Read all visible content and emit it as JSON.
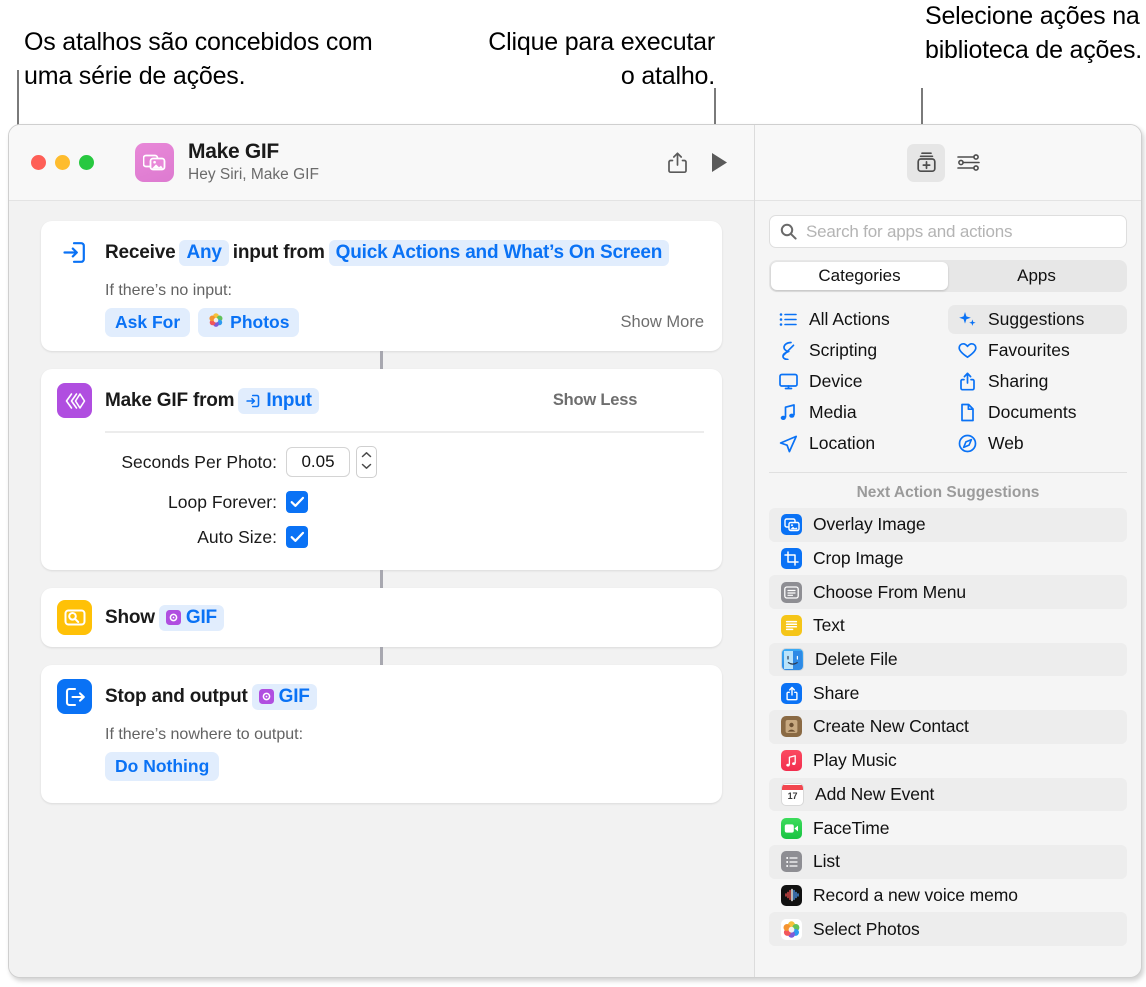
{
  "callouts": [
    {
      "id": "callout-shortcuts-series",
      "text": "Os atalhos são concebidos com uma série de ações."
    },
    {
      "id": "callout-run-shortcut",
      "text": "Clique para executar o atalho."
    },
    {
      "id": "callout-action-library",
      "text": "Selecione ações na biblioteca de ações."
    }
  ],
  "window": {
    "titlebar": {
      "app_icon": "photos-stack-icon",
      "title": "Make GIF",
      "subtitle": "Hey Siri, Make GIF",
      "share_button": "share-icon",
      "play_button": "play-icon",
      "action_library_button": "add-action-icon",
      "shortcut_details_button": "sliders-icon"
    },
    "actions": [
      {
        "icon": "receive-input-icon",
        "icon_color": "#ffffff",
        "title_parts": [
          {
            "type": "text",
            "text": "Receive"
          },
          {
            "type": "token",
            "text": "Any"
          },
          {
            "type": "text",
            "text": "input from"
          },
          {
            "type": "token",
            "text": "Quick Actions and What’s On Screen"
          }
        ],
        "toggle": "Show More",
        "sub_label": "If there’s no input:",
        "pills": [
          {
            "text": "Ask For",
            "icon": null
          },
          {
            "text": "Photos",
            "icon": "photos-icon"
          }
        ]
      },
      {
        "icon": "make-gif-icon",
        "icon_color": "#b04ee0",
        "title_parts": [
          {
            "type": "text",
            "text": "Make GIF from"
          },
          {
            "type": "token",
            "text": "Input",
            "icon": "input-icon"
          }
        ],
        "toggle": "Show Less",
        "params": [
          {
            "label": "Seconds Per Photo:",
            "type": "number",
            "value": "0.05"
          },
          {
            "label": "Loop Forever:",
            "type": "checkbox",
            "value": true
          },
          {
            "label": "Auto Size:",
            "type": "checkbox",
            "value": true
          }
        ]
      },
      {
        "icon": "quick-look-icon",
        "icon_color": "#ffc107",
        "title_parts": [
          {
            "type": "text",
            "text": "Show"
          },
          {
            "type": "token",
            "text": "GIF",
            "icon": "gif-var-icon"
          }
        ]
      },
      {
        "icon": "stop-output-icon",
        "icon_color": "#0a72f5",
        "title_parts": [
          {
            "type": "text",
            "text": "Stop and output"
          },
          {
            "type": "token",
            "text": "GIF",
            "icon": "gif-var-icon"
          }
        ],
        "sub_label": "If there’s nowhere to output:",
        "pills": [
          {
            "text": "Do Nothing",
            "icon": null
          }
        ]
      }
    ],
    "library": {
      "search_placeholder": "Search for apps and actions",
      "search_icon": "search-icon",
      "segments": [
        {
          "label": "Categories",
          "selected": true
        },
        {
          "label": "Apps",
          "selected": false
        }
      ],
      "categories": [
        {
          "label": "All Actions",
          "icon": "list-bullet-icon",
          "selected": false
        },
        {
          "label": "Suggestions",
          "icon": "sparkles-icon",
          "selected": true
        },
        {
          "label": "Scripting",
          "icon": "scripting-icon",
          "selected": false
        },
        {
          "label": "Favourites",
          "icon": "heart-icon",
          "selected": false
        },
        {
          "label": "Device",
          "icon": "display-icon",
          "selected": false
        },
        {
          "label": "Sharing",
          "icon": "share-icon",
          "selected": false
        },
        {
          "label": "Media",
          "icon": "music-note-icon",
          "selected": false
        },
        {
          "label": "Documents",
          "icon": "document-icon",
          "selected": false
        },
        {
          "label": "Location",
          "icon": "paper-plane-icon",
          "selected": false
        },
        {
          "label": "Web",
          "icon": "safari-icon",
          "selected": false
        }
      ],
      "suggestions_heading": "Next Action Suggestions",
      "suggestions": [
        {
          "label": "Overlay Image",
          "icon": "overlay-image-icon"
        },
        {
          "label": "Crop Image",
          "icon": "crop-image-icon"
        },
        {
          "label": "Choose From Menu",
          "icon": "choose-from-menu-icon"
        },
        {
          "label": "Text",
          "icon": "text-icon"
        },
        {
          "label": "Delete File",
          "icon": "finder-icon"
        },
        {
          "label": "Share",
          "icon": "share-action-icon"
        },
        {
          "label": "Create New Contact",
          "icon": "contacts-icon"
        },
        {
          "label": "Play Music",
          "icon": "music-icon"
        },
        {
          "label": "Add New Event",
          "icon": "calendar-icon"
        },
        {
          "label": "FaceTime",
          "icon": "facetime-icon"
        },
        {
          "label": "List",
          "icon": "list-icon"
        },
        {
          "label": "Record a new voice memo",
          "icon": "voice-memos-icon"
        },
        {
          "label": "Select Photos",
          "icon": "photos-icon"
        }
      ],
      "calendar_day": "17"
    }
  },
  "colors": {
    "accent_blue": "#0a72f5",
    "token_bg": "#e1edfd",
    "purple": "#b04ee0",
    "yellow": "#ffc107"
  }
}
